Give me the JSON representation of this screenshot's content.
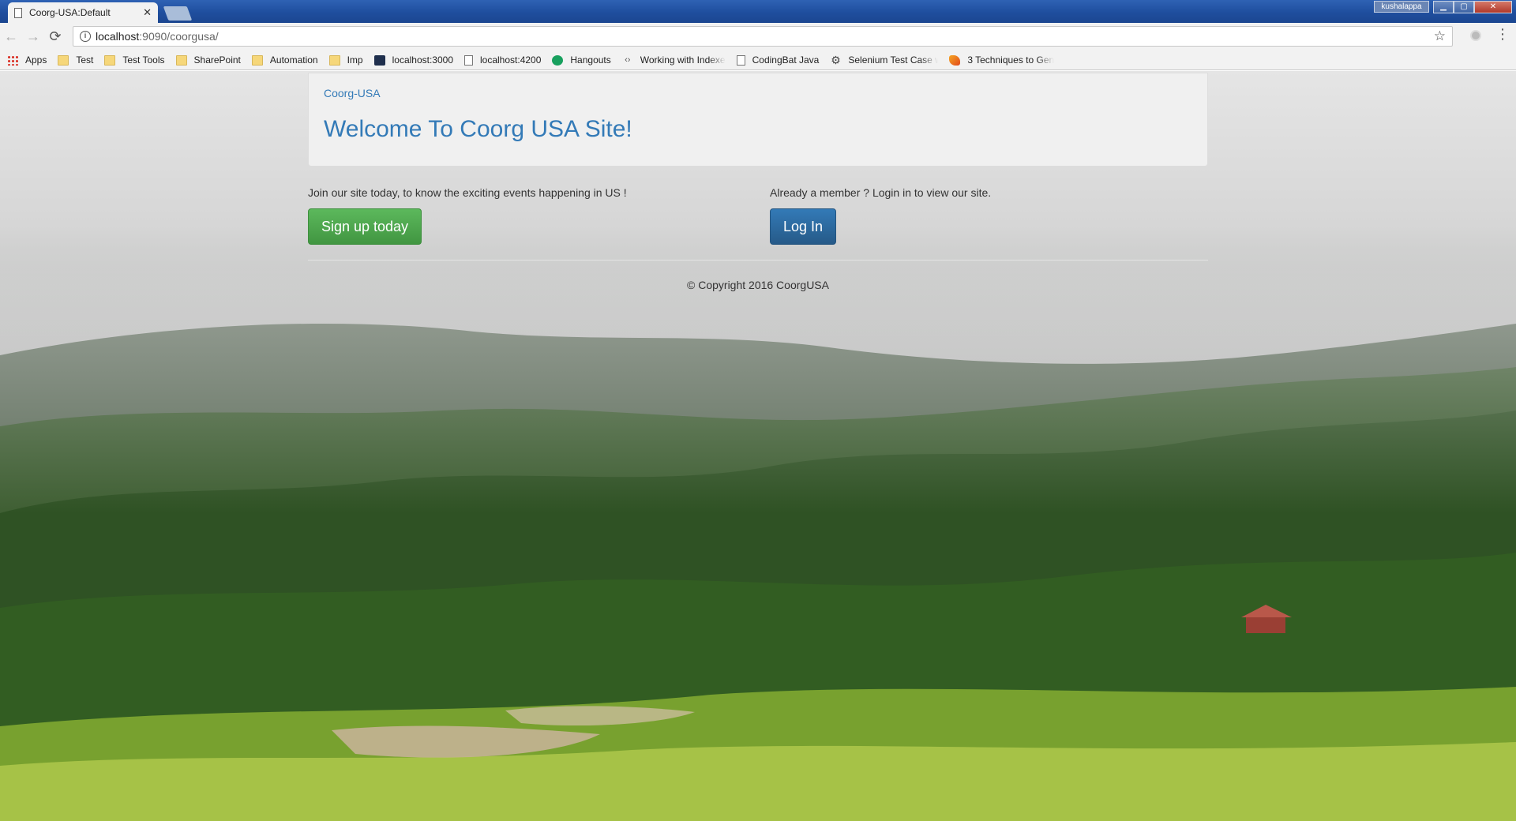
{
  "browser": {
    "tab_title": "Coorg-USA:Default",
    "tab_close": "✕",
    "user_name": "kushalappa",
    "url_host": "localhost",
    "url_rest": ":9090/coorgusa/",
    "bookmarks": [
      {
        "label": "Apps",
        "icon": "apps-icon"
      },
      {
        "label": "Test",
        "icon": "folder-icon"
      },
      {
        "label": "Test Tools",
        "icon": "folder-icon"
      },
      {
        "label": "SharePoint",
        "icon": "folder-icon"
      },
      {
        "label": "Automation",
        "icon": "folder-icon"
      },
      {
        "label": "Imp",
        "icon": "folder-icon"
      },
      {
        "label": "localhost:3000",
        "icon": "react-icon"
      },
      {
        "label": "localhost:4200",
        "icon": "page-icon"
      },
      {
        "label": "Hangouts",
        "icon": "hangouts-icon"
      },
      {
        "label": "Working with Indexe",
        "icon": "code-icon"
      },
      {
        "label": "CodingBat Java",
        "icon": "page-icon"
      },
      {
        "label": "Selenium Test Case w",
        "icon": "gear-icon"
      },
      {
        "label": "3 Techniques to Gen",
        "icon": "flame-icon"
      }
    ]
  },
  "page": {
    "brand": "Coorg-USA",
    "title": "Welcome To Coorg USA Site!",
    "join_text": "Join our site today, to know the exciting events happening in US !",
    "signup_label": "Sign up today",
    "member_text": "Already a member ? Login in to view our site.",
    "login_label": "Log In",
    "footer": "© Copyright 2016 CoorgUSA"
  },
  "colors": {
    "link_blue": "#337ab7",
    "success_green": "#5cb85c",
    "primary_blue": "#265a88"
  }
}
